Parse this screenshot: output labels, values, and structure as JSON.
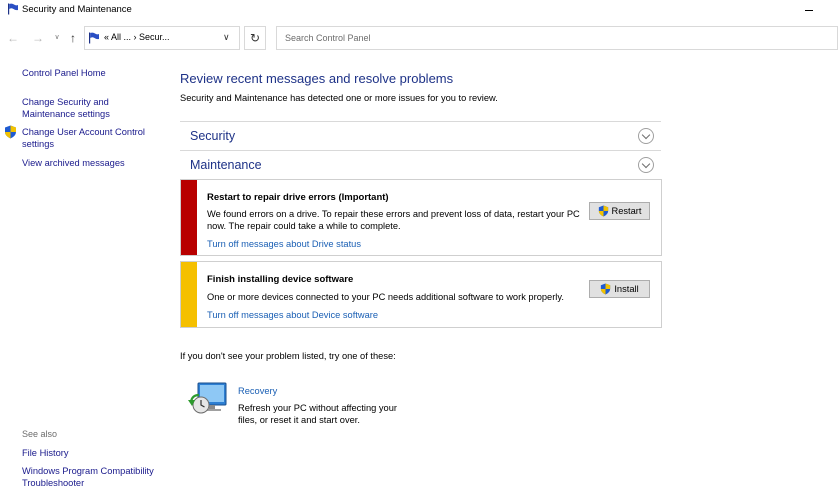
{
  "window": {
    "title": "Security and Maintenance"
  },
  "nav": {
    "address_text": "«  All ...  ›  Secur...",
    "search_placeholder": "Search Control Panel"
  },
  "sidebar": {
    "items": [
      {
        "label": "Control Panel Home"
      },
      {
        "label": "Change Security and Maintenance settings"
      },
      {
        "label": "Change User Account Control settings"
      },
      {
        "label": "View archived messages"
      }
    ],
    "see_also_label": "See also",
    "see_also": [
      {
        "label": "File History"
      },
      {
        "label": "Windows Program Compatibility Troubleshooter"
      }
    ]
  },
  "main": {
    "heading": "Review recent messages and resolve problems",
    "subheading": "Security and Maintenance has detected one or more issues for you to review.",
    "sections": [
      {
        "label": "Security"
      },
      {
        "label": "Maintenance"
      }
    ],
    "messages": [
      {
        "title": "Restart to repair drive errors  (Important)",
        "description": "We found errors on a drive. To repair these errors and prevent loss of data, restart your PC now. The repair could take a while to complete.",
        "link": "Turn off messages about Drive status",
        "button": "Restart",
        "color": "#b80000"
      },
      {
        "title": "Finish installing device software",
        "description": "One or more devices connected to your PC needs additional software to work properly.",
        "link": "Turn off messages about Device software",
        "button": "Install",
        "color": "#f5c000"
      }
    ],
    "try_text": "If you don't see your problem listed, try one of these:",
    "recovery": {
      "link": "Recovery",
      "description": "Refresh your PC without affecting your files, or reset it and start over."
    }
  },
  "colors": {
    "heading_blue": "#1e3287",
    "link_blue": "#1a5fb4",
    "critical_red": "#b80000",
    "warning_yellow": "#f5c000"
  }
}
